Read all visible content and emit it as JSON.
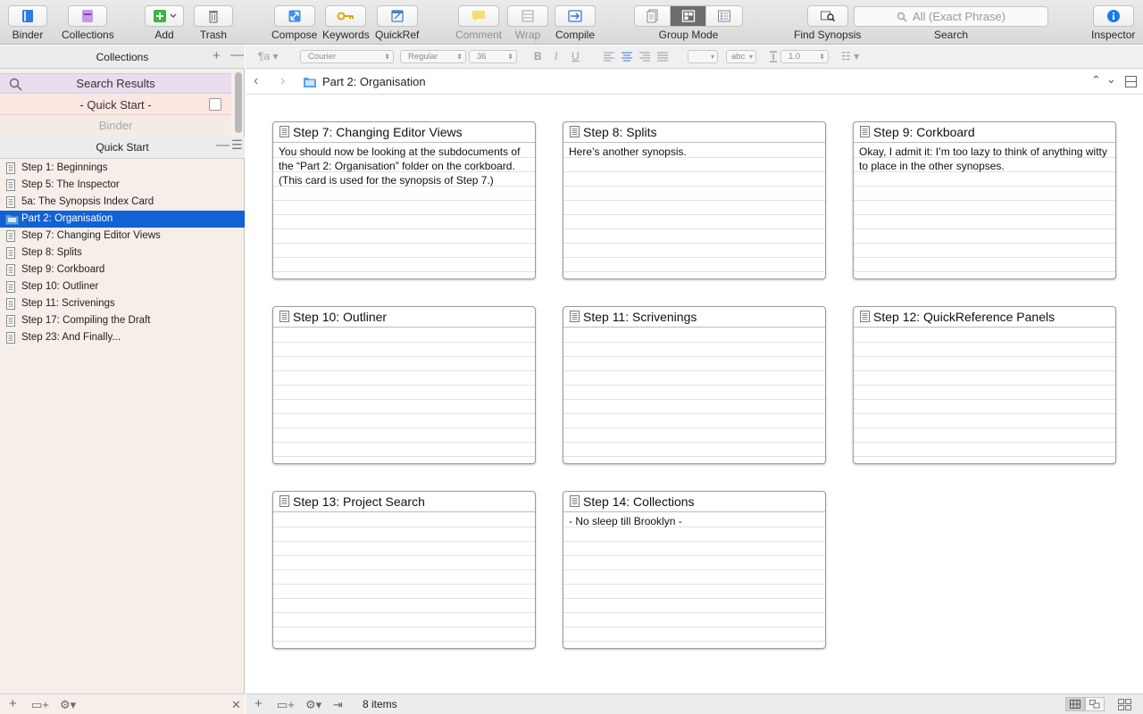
{
  "toolbar": {
    "binder": "Binder",
    "collections": "Collections",
    "add": "Add",
    "trash": "Trash",
    "compose": "Compose",
    "keywords": "Keywords",
    "quickref": "QuickRef",
    "comment": "Comment",
    "wrap": "Wrap",
    "compile": "Compile",
    "group_mode": "Group Mode",
    "find_synopsis": "Find Synopsis",
    "search_placeholder": "All (Exact Phrase)",
    "search": "Search",
    "inspector": "Inspector"
  },
  "sidebar": {
    "collections_header": "Collections",
    "collections": [
      {
        "label": "Search Results"
      },
      {
        "label": "- Quick Start -"
      },
      {
        "label": "Binder"
      }
    ],
    "binder_header": "Quick Start",
    "items": [
      {
        "label": "Step 1: Beginnings",
        "icon": "document-icon"
      },
      {
        "label": "Step 5: The Inspector",
        "icon": "document-icon"
      },
      {
        "label": "5a: The Synopsis Index Card",
        "icon": "document-icon"
      },
      {
        "label": "Part 2: Organisation",
        "icon": "folder-icon"
      },
      {
        "label": "Step 7: Changing Editor Views",
        "icon": "document-icon"
      },
      {
        "label": "Step 8: Splits",
        "icon": "document-icon"
      },
      {
        "label": "Step 9: Corkboard",
        "icon": "document-icon"
      },
      {
        "label": "Step 10: Outliner",
        "icon": "document-icon"
      },
      {
        "label": "Step 11: Scrivenings",
        "icon": "document-icon"
      },
      {
        "label": "Step 17: Compiling the Draft",
        "icon": "document-icon"
      },
      {
        "label": "Step 23: And Finally...",
        "icon": "document-icon"
      }
    ],
    "selected_index": 3
  },
  "formatbar": {
    "font": "Courier",
    "style": "Regular",
    "size": "36",
    "line_spacing": "1.0",
    "highlight_sample": "abc"
  },
  "editor": {
    "title": "Part 2: Organisation",
    "cards": [
      {
        "title": "Step 7: Changing Editor Views",
        "synopsis": "You should now be looking at the subdocuments of the “Part 2: Organisation” folder on the corkboard. (This card is used for the synopsis of Step 7.)"
      },
      {
        "title": "Step 8: Splits",
        "synopsis": "Here’s another synopsis."
      },
      {
        "title": "Step 9: Corkboard",
        "synopsis": "Okay, I admit it: I’m too lazy to think of anything witty to place in the other synopses."
      },
      {
        "title": "Step 10: Outliner",
        "synopsis": ""
      },
      {
        "title": "Step 11: Scrivenings",
        "synopsis": ""
      },
      {
        "title": "Step 12: QuickReference Panels",
        "synopsis": ""
      },
      {
        "title": "Step 13: Project Search",
        "synopsis": ""
      },
      {
        "title": "Step 14: Collections",
        "synopsis": "- No sleep till Brooklyn -"
      }
    ]
  },
  "footer": {
    "item_count": "8 items"
  },
  "colors": {
    "selection": "#1162d5",
    "sidebar_bg": "#f6eee9",
    "add_green": "#3db53d",
    "collections_purple": "#b07cd6",
    "inspector_blue": "#1a7ce6"
  }
}
